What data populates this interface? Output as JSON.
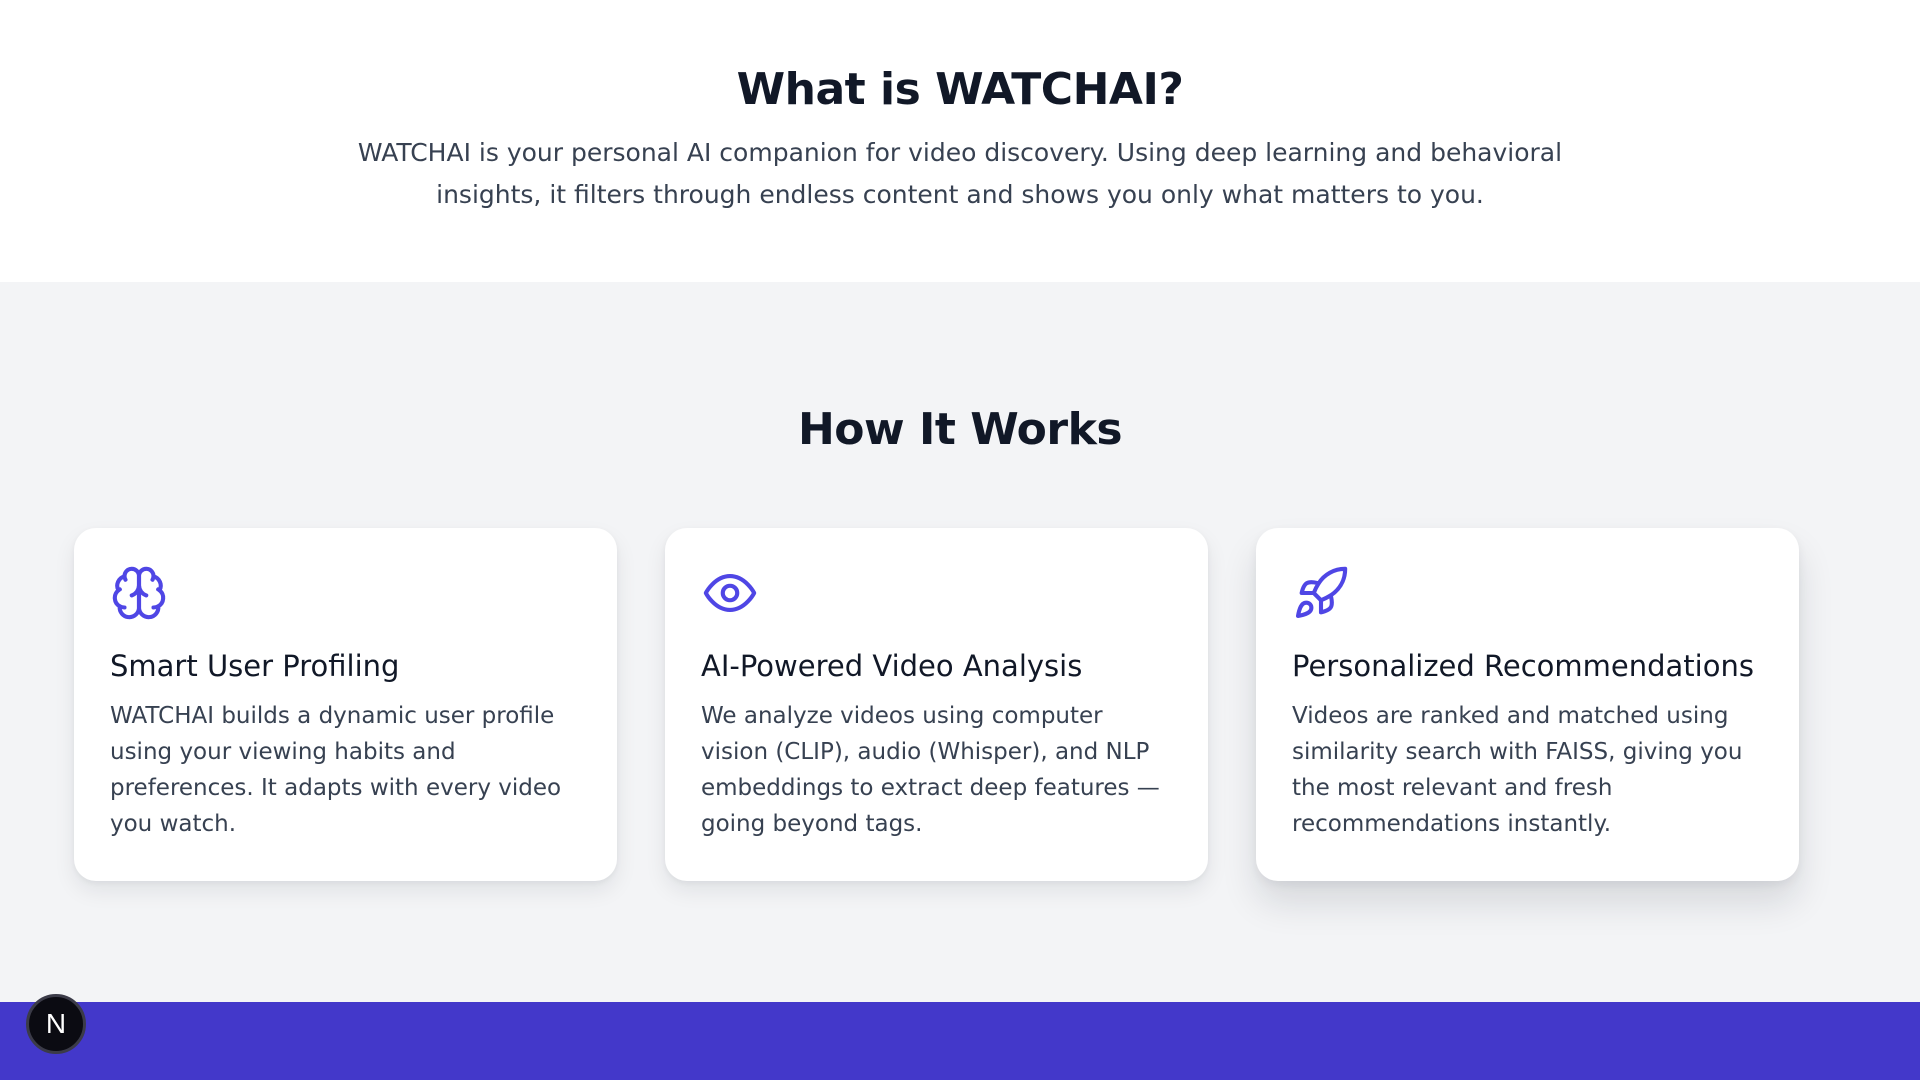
{
  "about": {
    "title": "What is WATCHAI?",
    "description": "WATCHAI is your personal AI companion for video discovery. Using deep learning and behavioral insights, it filters through endless content and shows you only what matters to you."
  },
  "how_it_works": {
    "title": "How It Works",
    "cards": [
      {
        "icon": "brain-icon",
        "title": "Smart User Profiling",
        "text": "WATCHAI builds a dynamic user profile using your viewing habits and preferences. It adapts with every video you watch."
      },
      {
        "icon": "eye-icon",
        "title": "AI-Powered Video Analysis",
        "text": "We analyze videos using computer vision (CLIP), audio (Whisper), and NLP embeddings to extract deep features — going beyond tags."
      },
      {
        "icon": "rocket-icon",
        "title": "Personalized Recommendations",
        "text": "Videos are ranked and matched using similarity search with FAISS, giving you the most relevant and fresh recommendations instantly."
      }
    ]
  },
  "dev_badge": {
    "label": "N"
  },
  "colors": {
    "accent": "#4338ca",
    "icon": "#4f46e5",
    "section_bg": "#f3f4f6",
    "heading": "#111827",
    "body_text": "#374151"
  }
}
